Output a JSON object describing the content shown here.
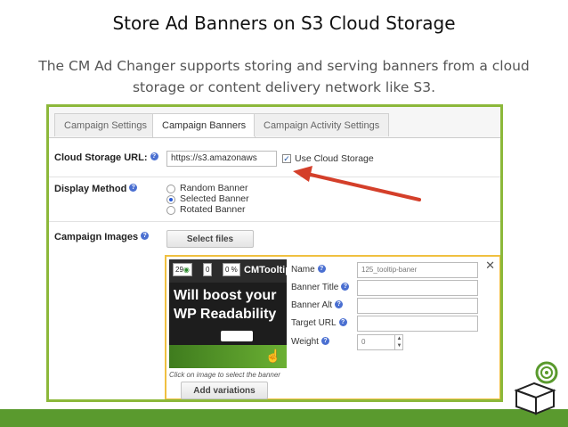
{
  "slide": {
    "title": "Store Ad Banners on S3 Cloud Storage",
    "subtitle_line1": "The CM Ad Changer supports storing and serving banners from a cloud",
    "subtitle_line2": "storage or content delivery network like S3."
  },
  "tabs": [
    "Campaign Settings",
    "Campaign Banners",
    "Campaign Activity Settings"
  ],
  "active_tab": "Campaign Banners",
  "cloud": {
    "label": "Cloud Storage URL:",
    "url_value": "https://s3.amazonaws",
    "checkbox_label": "Use Cloud Storage",
    "checked_mark": "✓"
  },
  "display": {
    "label": "Display Method",
    "options": [
      "Random Banner",
      "Selected Banner",
      "Rotated Banner"
    ],
    "selected": "Selected Banner"
  },
  "images": {
    "label": "Campaign Images",
    "select_button": "Select files"
  },
  "banner": {
    "stat_views": "29",
    "stat_clicks": "0",
    "stat_pct": "0 %",
    "brand": "CMTooltip",
    "line1": "Will",
    "bold_word": "boost",
    "line1_end": "your",
    "line2": "WP Readability",
    "caption": "Click on image to select the banner",
    "add_variations": "Add variations"
  },
  "fields": {
    "name_label": "Name",
    "name_value": "125_tooltip-baner",
    "title_label": "Banner Title",
    "alt_label": "Banner Alt",
    "url_label": "Target URL",
    "weight_label": "Weight",
    "weight_value": "0"
  },
  "icons": {
    "help": "question-circle-icon",
    "close": "close-icon",
    "arrow": "red-arrow-annotation"
  },
  "colors": {
    "frame": "#8cb83a",
    "panel_border": "#f0c040",
    "arrow": "#d43f2a",
    "footer": "#5a9a2e"
  }
}
